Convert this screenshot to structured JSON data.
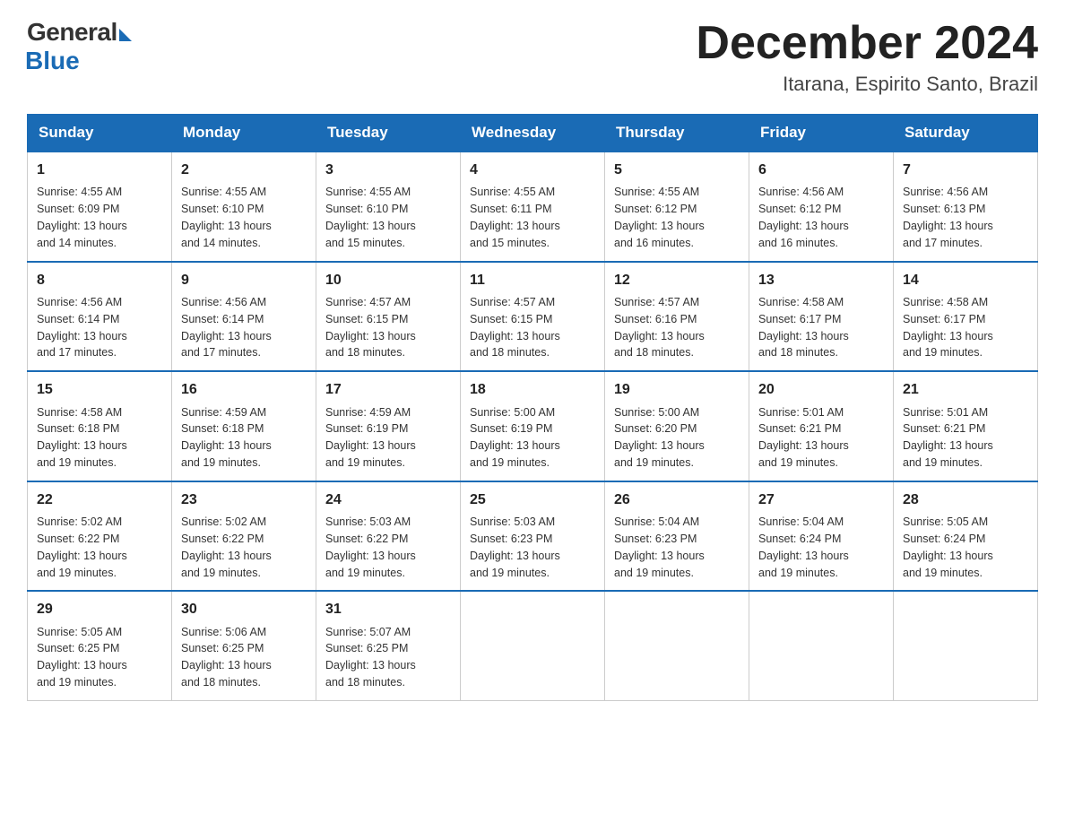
{
  "logo": {
    "general": "General",
    "blue": "Blue"
  },
  "header": {
    "month": "December 2024",
    "location": "Itarana, Espirito Santo, Brazil"
  },
  "days_of_week": [
    "Sunday",
    "Monday",
    "Tuesday",
    "Wednesday",
    "Thursday",
    "Friday",
    "Saturday"
  ],
  "weeks": [
    [
      {
        "day": "1",
        "sunrise": "4:55 AM",
        "sunset": "6:09 PM",
        "daylight": "13 hours and 14 minutes."
      },
      {
        "day": "2",
        "sunrise": "4:55 AM",
        "sunset": "6:10 PM",
        "daylight": "13 hours and 14 minutes."
      },
      {
        "day": "3",
        "sunrise": "4:55 AM",
        "sunset": "6:10 PM",
        "daylight": "13 hours and 15 minutes."
      },
      {
        "day": "4",
        "sunrise": "4:55 AM",
        "sunset": "6:11 PM",
        "daylight": "13 hours and 15 minutes."
      },
      {
        "day": "5",
        "sunrise": "4:55 AM",
        "sunset": "6:12 PM",
        "daylight": "13 hours and 16 minutes."
      },
      {
        "day": "6",
        "sunrise": "4:56 AM",
        "sunset": "6:12 PM",
        "daylight": "13 hours and 16 minutes."
      },
      {
        "day": "7",
        "sunrise": "4:56 AM",
        "sunset": "6:13 PM",
        "daylight": "13 hours and 17 minutes."
      }
    ],
    [
      {
        "day": "8",
        "sunrise": "4:56 AM",
        "sunset": "6:14 PM",
        "daylight": "13 hours and 17 minutes."
      },
      {
        "day": "9",
        "sunrise": "4:56 AM",
        "sunset": "6:14 PM",
        "daylight": "13 hours and 17 minutes."
      },
      {
        "day": "10",
        "sunrise": "4:57 AM",
        "sunset": "6:15 PM",
        "daylight": "13 hours and 18 minutes."
      },
      {
        "day": "11",
        "sunrise": "4:57 AM",
        "sunset": "6:15 PM",
        "daylight": "13 hours and 18 minutes."
      },
      {
        "day": "12",
        "sunrise": "4:57 AM",
        "sunset": "6:16 PM",
        "daylight": "13 hours and 18 minutes."
      },
      {
        "day": "13",
        "sunrise": "4:58 AM",
        "sunset": "6:17 PM",
        "daylight": "13 hours and 18 minutes."
      },
      {
        "day": "14",
        "sunrise": "4:58 AM",
        "sunset": "6:17 PM",
        "daylight": "13 hours and 19 minutes."
      }
    ],
    [
      {
        "day": "15",
        "sunrise": "4:58 AM",
        "sunset": "6:18 PM",
        "daylight": "13 hours and 19 minutes."
      },
      {
        "day": "16",
        "sunrise": "4:59 AM",
        "sunset": "6:18 PM",
        "daylight": "13 hours and 19 minutes."
      },
      {
        "day": "17",
        "sunrise": "4:59 AM",
        "sunset": "6:19 PM",
        "daylight": "13 hours and 19 minutes."
      },
      {
        "day": "18",
        "sunrise": "5:00 AM",
        "sunset": "6:19 PM",
        "daylight": "13 hours and 19 minutes."
      },
      {
        "day": "19",
        "sunrise": "5:00 AM",
        "sunset": "6:20 PM",
        "daylight": "13 hours and 19 minutes."
      },
      {
        "day": "20",
        "sunrise": "5:01 AM",
        "sunset": "6:21 PM",
        "daylight": "13 hours and 19 minutes."
      },
      {
        "day": "21",
        "sunrise": "5:01 AM",
        "sunset": "6:21 PM",
        "daylight": "13 hours and 19 minutes."
      }
    ],
    [
      {
        "day": "22",
        "sunrise": "5:02 AM",
        "sunset": "6:22 PM",
        "daylight": "13 hours and 19 minutes."
      },
      {
        "day": "23",
        "sunrise": "5:02 AM",
        "sunset": "6:22 PM",
        "daylight": "13 hours and 19 minutes."
      },
      {
        "day": "24",
        "sunrise": "5:03 AM",
        "sunset": "6:22 PM",
        "daylight": "13 hours and 19 minutes."
      },
      {
        "day": "25",
        "sunrise": "5:03 AM",
        "sunset": "6:23 PM",
        "daylight": "13 hours and 19 minutes."
      },
      {
        "day": "26",
        "sunrise": "5:04 AM",
        "sunset": "6:23 PM",
        "daylight": "13 hours and 19 minutes."
      },
      {
        "day": "27",
        "sunrise": "5:04 AM",
        "sunset": "6:24 PM",
        "daylight": "13 hours and 19 minutes."
      },
      {
        "day": "28",
        "sunrise": "5:05 AM",
        "sunset": "6:24 PM",
        "daylight": "13 hours and 19 minutes."
      }
    ],
    [
      {
        "day": "29",
        "sunrise": "5:05 AM",
        "sunset": "6:25 PM",
        "daylight": "13 hours and 19 minutes."
      },
      {
        "day": "30",
        "sunrise": "5:06 AM",
        "sunset": "6:25 PM",
        "daylight": "13 hours and 18 minutes."
      },
      {
        "day": "31",
        "sunrise": "5:07 AM",
        "sunset": "6:25 PM",
        "daylight": "13 hours and 18 minutes."
      },
      null,
      null,
      null,
      null
    ]
  ],
  "labels": {
    "sunrise": "Sunrise:",
    "sunset": "Sunset:",
    "daylight": "Daylight:"
  },
  "colors": {
    "header_bg": "#1a6bb5",
    "header_text": "#ffffff",
    "border_top": "#1a6bb5"
  }
}
